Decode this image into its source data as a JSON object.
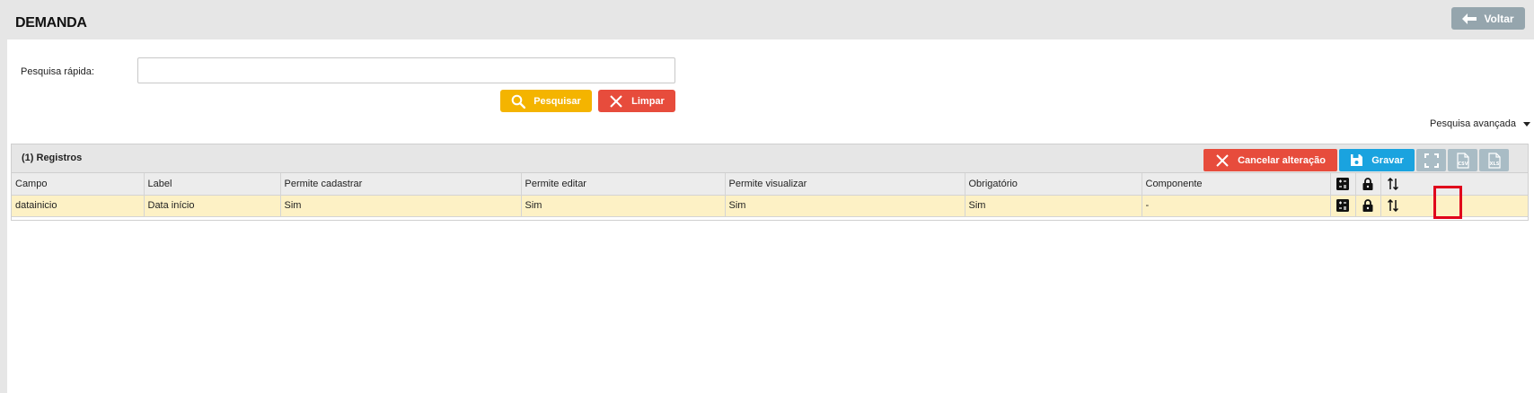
{
  "header": {
    "title": "DEMANDA",
    "back_label": "Voltar"
  },
  "search": {
    "label": "Pesquisa rápida:",
    "value": "",
    "placeholder": "",
    "search_label": "Pesquisar",
    "clear_label": "Limpar",
    "advanced_label": "Pesquisa avançada"
  },
  "grid": {
    "count_label": "(1) Registros",
    "toolbar": {
      "cancel_label": "Cancelar alteração",
      "save_label": "Gravar",
      "fullscreen_icon": "fullscreen-icon",
      "csv_icon": "csv-file-icon",
      "xls_icon": "xls-file-icon"
    },
    "columns": [
      "Campo",
      "Label",
      "Permite cadastrar",
      "Permite editar",
      "Permite visualizar",
      "Obrigatório",
      "Componente"
    ],
    "icon_columns": [
      "calculator-icon",
      "lock-icon",
      "sort-arrows-icon"
    ],
    "rows": [
      {
        "campo": "datainicio",
        "label": "Data início",
        "permite_cadastrar": "Sim",
        "permite_editar": "Sim",
        "permite_visualizar": "Sim",
        "obrigatorio": "Sim",
        "componente": "-"
      }
    ]
  },
  "colors": {
    "page_bg": "#e6e6e6",
    "back_button": "#95a5ad",
    "search_button": "#f4b400",
    "danger_button": "#e74c3c",
    "save_button": "#1aa3df",
    "icon_button": "#a9bcc5",
    "row_highlight": "#fdf1c5",
    "highlight_box": "#e0001b"
  }
}
